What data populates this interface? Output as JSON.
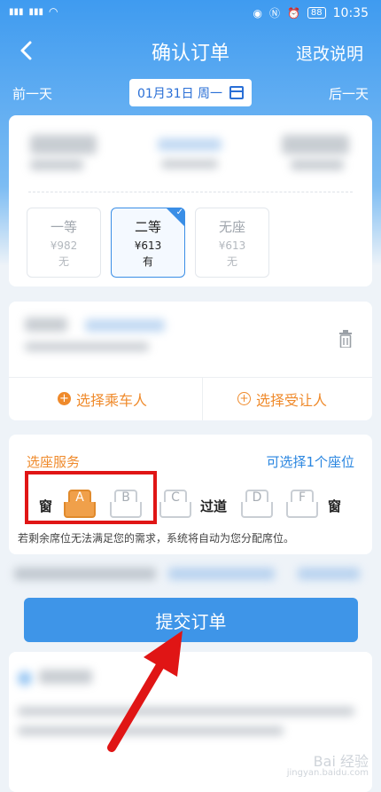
{
  "status": {
    "time": "10:35",
    "battery": "88"
  },
  "nav": {
    "title": "确认订单",
    "right_link": "退改说明"
  },
  "date_bar": {
    "prev": "前一天",
    "date": "01月31日 周一",
    "next": "后一天"
  },
  "seat_classes": [
    {
      "name": "一等",
      "price": "¥982",
      "availability": "无",
      "selected": false
    },
    {
      "name": "二等",
      "price": "¥613",
      "availability": "有",
      "selected": true
    },
    {
      "name": "无座",
      "price": "¥613",
      "availability": "无",
      "selected": false
    }
  ],
  "passenger": {
    "select_passenger": "选择乘车人",
    "select_beneficiary": "选择受让人"
  },
  "seat_service": {
    "title": "选座服务",
    "hint": "可选择1个座位",
    "window_left": "窗",
    "aisle": "过道",
    "window_right": "窗",
    "seats": [
      "A",
      "B",
      "C",
      "D",
      "F"
    ],
    "selected_seat": "A",
    "note": "若剩余席位无法满足您的需求，系统将自动为您分配席位。"
  },
  "submit": {
    "label": "提交订单"
  },
  "watermark": {
    "text": "Bai 经验",
    "sub": "jingyan.baidu.com"
  },
  "colors": {
    "primary": "#3e95e8",
    "accent": "#ef8a2b",
    "highlight": "#e01515"
  }
}
